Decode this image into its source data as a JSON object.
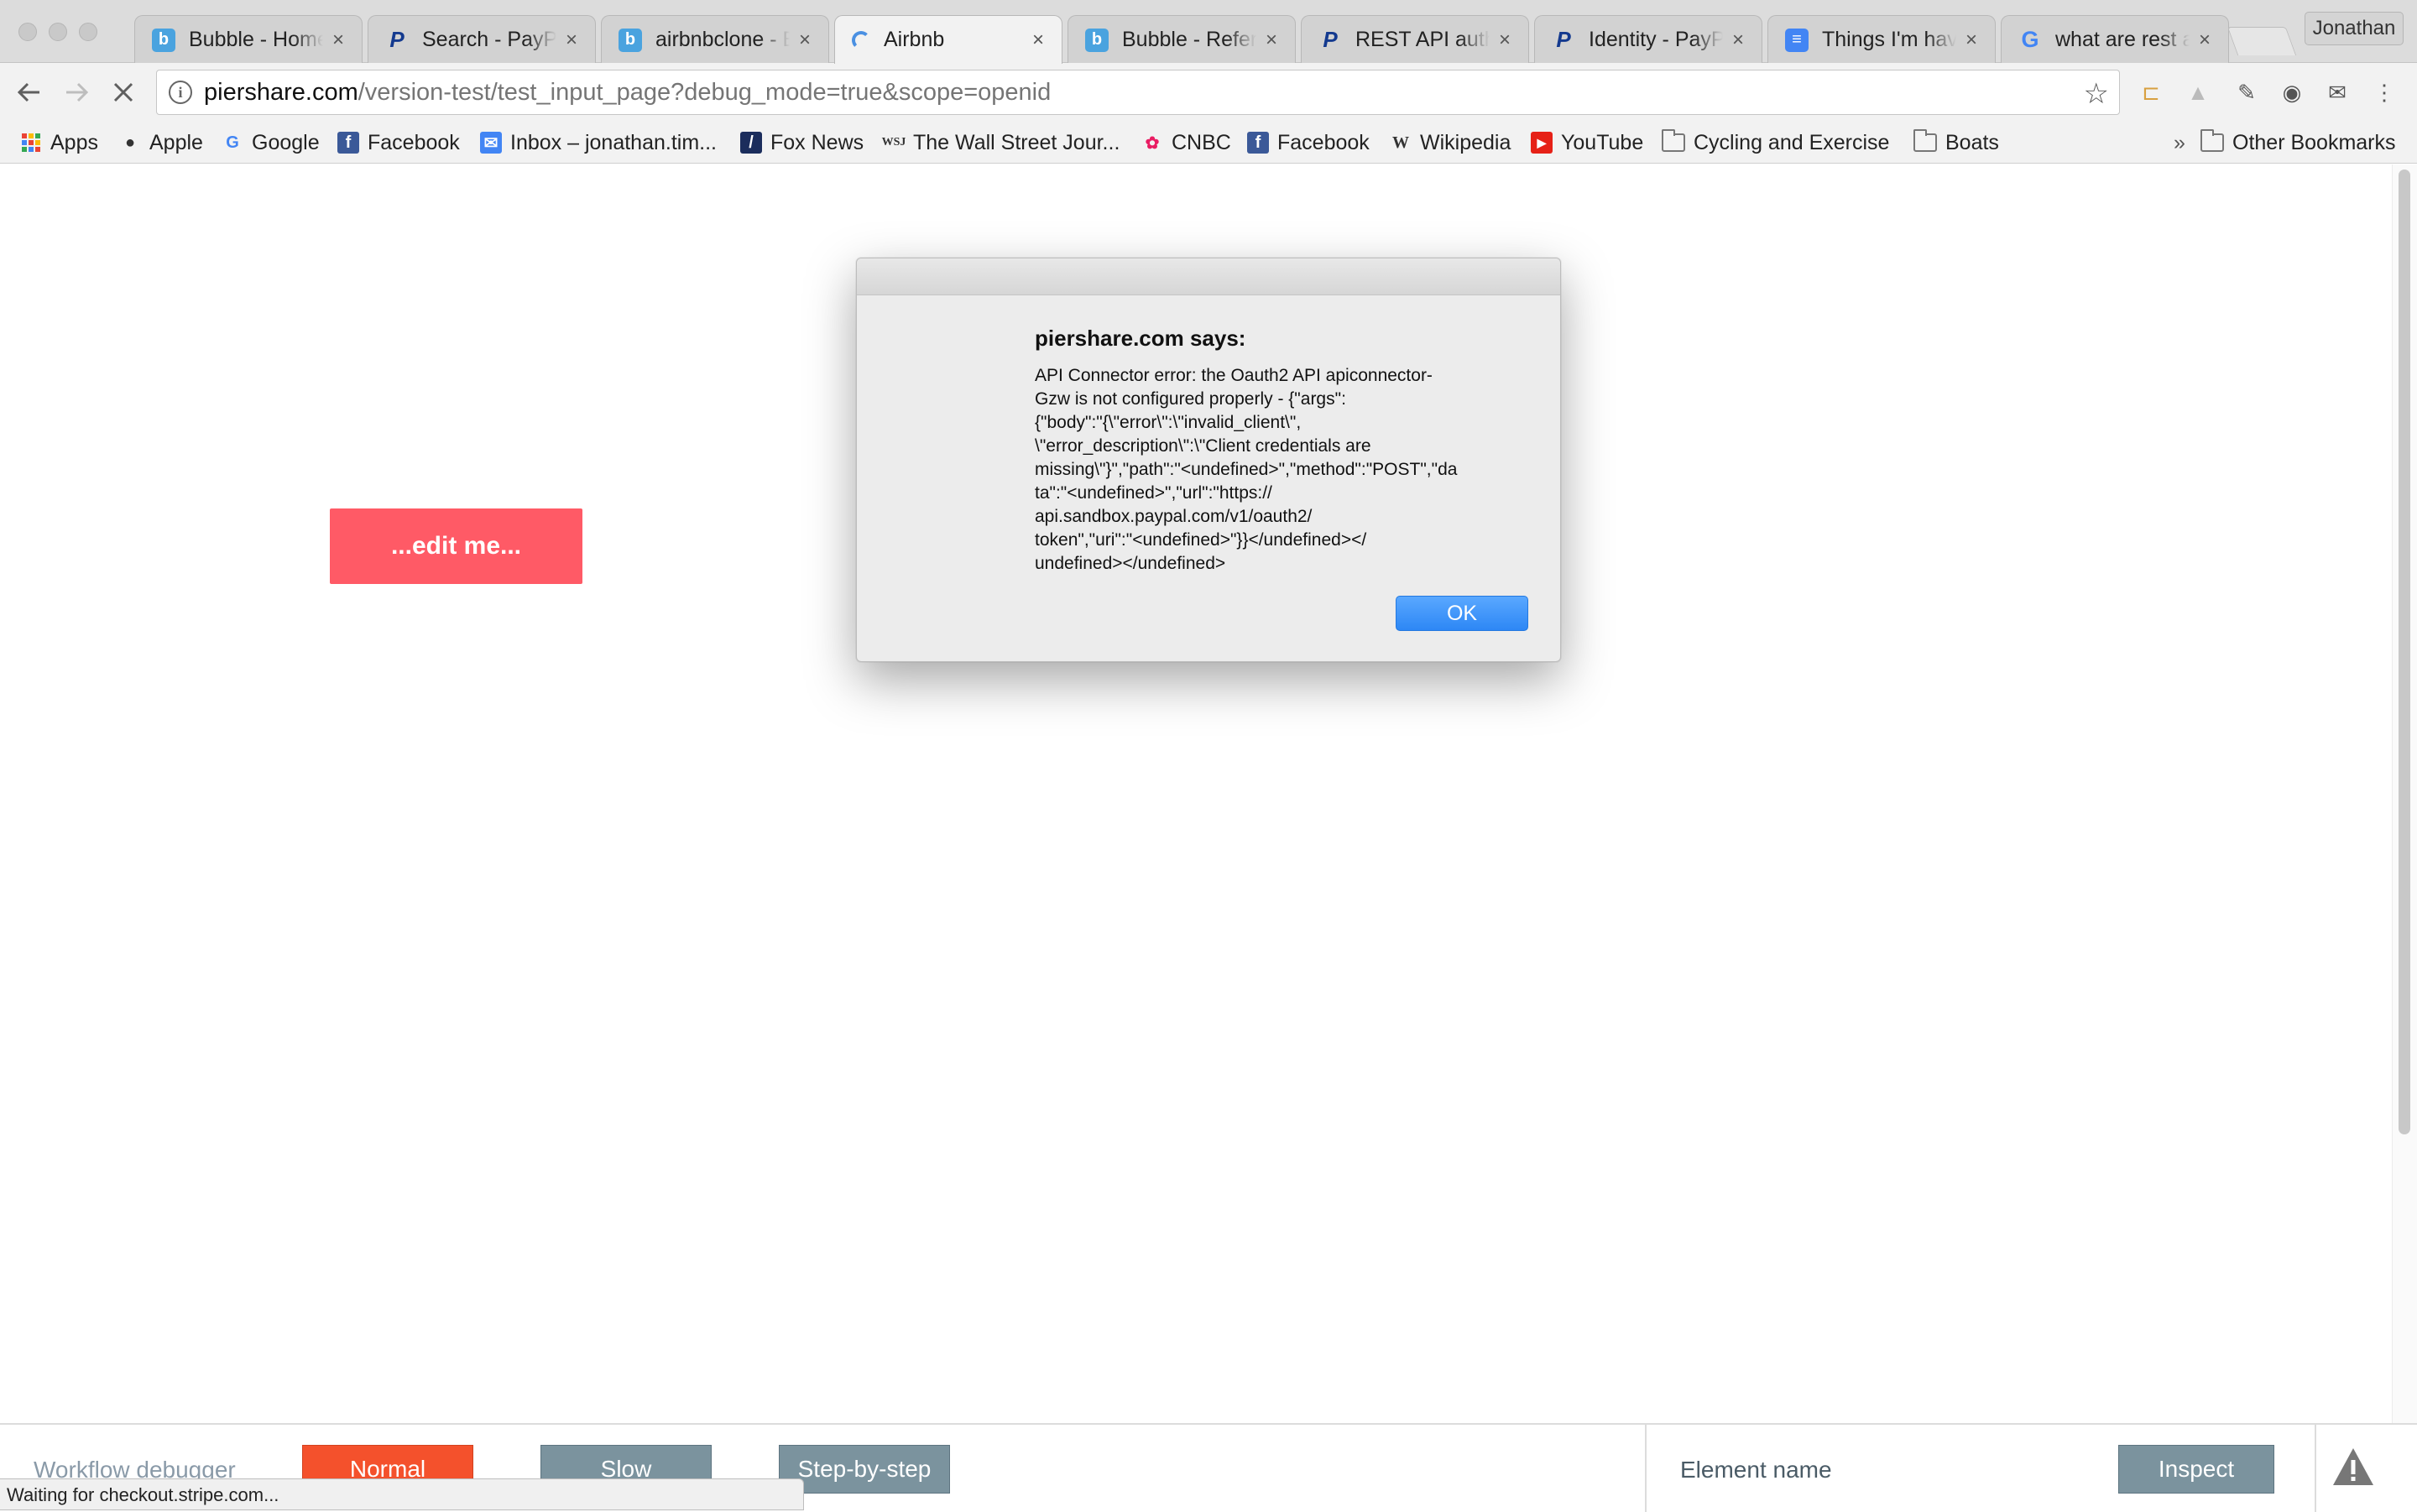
{
  "tabs": [
    {
      "title": "Bubble - Home",
      "icon": "bubble-icon"
    },
    {
      "title": "Search - PayPal",
      "icon": "paypal-icon"
    },
    {
      "title": "airbnbclone - Bubble",
      "icon": "bubble-icon"
    },
    {
      "title": "Airbnb",
      "icon": "loading-spinner-icon",
      "active": true
    },
    {
      "title": "Bubble - Reference",
      "icon": "bubble-icon"
    },
    {
      "title": "REST API authentication",
      "icon": "paypal-icon"
    },
    {
      "title": "Identity - PayPal",
      "icon": "paypal-icon"
    },
    {
      "title": "Things I'm having trouble with",
      "icon": "docs-icon"
    },
    {
      "title": "what are rest api",
      "icon": "google-icon"
    }
  ],
  "profile_name": "Jonathan",
  "address": {
    "host": "piershare.com",
    "path": "/version-test/test_input_page?debug_mode=true&scope=openid"
  },
  "bookmarks": [
    {
      "label": "Apps",
      "icon": "apps-grid-icon"
    },
    {
      "label": "Apple",
      "icon": "apple-icon"
    },
    {
      "label": "Google",
      "icon": "google-icon"
    },
    {
      "label": "Facebook",
      "icon": "facebook-icon"
    },
    {
      "label": "Inbox – jonathan.tim...",
      "icon": "inbox-icon"
    },
    {
      "label": "Fox News",
      "icon": "foxnews-icon"
    },
    {
      "label": "The Wall Street Jour...",
      "icon": "wsj-icon"
    },
    {
      "label": "CNBC",
      "icon": "cnbc-icon"
    },
    {
      "label": "Facebook",
      "icon": "facebook-icon"
    },
    {
      "label": "Wikipedia",
      "icon": "wikipedia-icon"
    },
    {
      "label": "YouTube",
      "icon": "youtube-icon"
    },
    {
      "label": "Cycling and Exercise",
      "icon": "folder-icon"
    },
    {
      "label": "Boats",
      "icon": "folder-icon"
    }
  ],
  "bookmarks_overflow": "»",
  "other_bookmarks": "Other Bookmarks",
  "page": {
    "edit_button_label": "...edit me..."
  },
  "alert": {
    "heading": "piershare.com says:",
    "message": "API Connector error: the Oauth2 API apiconnector-\nGzw is not configured properly - {\"args\":\n{\"body\":\"{\\\"error\\\":\\\"invalid_client\\\",\n\\\"error_description\\\":\\\"Client credentials are\nmissing\\\"}\",\"path\":\"<undefined>\",\"method\":\"POST\",\"da\nta\":\"<undefined>\",\"url\":\"https://\napi.sandbox.paypal.com/v1/oauth2/\ntoken\",\"uri\":\"<undefined>\"}}</undefined></\nundefined></undefined>",
    "ok_label": "OK"
  },
  "debugger": {
    "title": "Workflow debugger",
    "modes": [
      "Normal",
      "Slow",
      "Step-by-step"
    ],
    "active_mode": "Normal",
    "element_name_placeholder": "Element name",
    "inspect_label": "Inspect"
  },
  "status_text": "Waiting for checkout.stripe.com...",
  "colors": {
    "edit_button": "#ff5a66",
    "ok_button": "#2d87f5",
    "normal_mode": "#f4512c",
    "debug_button": "#7b939e"
  }
}
